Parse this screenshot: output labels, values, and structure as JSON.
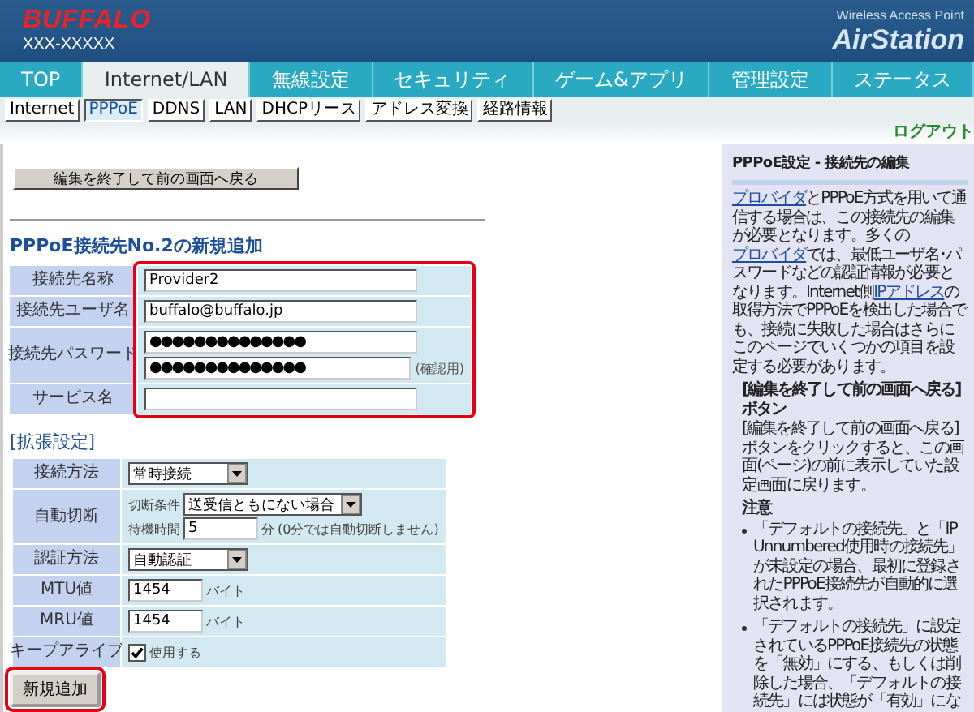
{
  "header": {
    "brand": "BUFFALO",
    "model": "XXX-XXXXX",
    "product_line": "Wireless Access Point",
    "product": "AirStation"
  },
  "nav_tabs": [
    {
      "label": "TOP",
      "selected": false
    },
    {
      "label": "Internet/LAN",
      "selected": true
    },
    {
      "label": "無線設定",
      "selected": false
    },
    {
      "label": "セキュリティ",
      "selected": false
    },
    {
      "label": "ゲーム&アプリ",
      "selected": false
    },
    {
      "label": "管理設定",
      "selected": false
    },
    {
      "label": "ステータス",
      "selected": false
    }
  ],
  "sub_tabs": [
    {
      "label": "Internet",
      "selected": false
    },
    {
      "label": "PPPoE",
      "selected": true
    },
    {
      "label": "DDNS",
      "selected": false
    },
    {
      "label": "LAN",
      "selected": false
    },
    {
      "label": "DHCPリース",
      "selected": false
    },
    {
      "label": "アドレス変換",
      "selected": false
    },
    {
      "label": "経路情報",
      "selected": false
    }
  ],
  "logout": "ログアウト",
  "back_button": "編集を終了して前の画面へ戻る",
  "form_title": "PPPoE接続先No.2の新規追加",
  "basic": {
    "highlighted": true,
    "fields": [
      {
        "kind": "text",
        "label": "接続先名称",
        "value": "Provider2"
      },
      {
        "kind": "text",
        "label": "接続先ユーザ名",
        "value": "buffalo@buffalo.jp"
      },
      {
        "kind": "password",
        "label": "接続先パスワード",
        "value": "●●●●●●●●●●●●●●",
        "confirm_value": "●●●●●●●●●●●●●●",
        "confirm_note": "(確認用)"
      },
      {
        "kind": "text",
        "label": "サービス名"
      }
    ]
  },
  "advanced": {
    "heading": "[拡張設定]",
    "rows": [
      {
        "kind": "select",
        "label": "接続方法",
        "value": "常時接続"
      },
      {
        "kind": "auto_disconnect",
        "label": "自動切断",
        "condition_label": "切断条件",
        "condition": "送受信ともにない場合",
        "wait_label": "待機時間",
        "wait": "5",
        "wait_unit": "分",
        "wait_note": "(0分では自動切断しません)"
      },
      {
        "kind": "select",
        "label": "認証方法",
        "value": "自動認証"
      },
      {
        "kind": "number",
        "label": "MTU値",
        "value": "1454",
        "unit": "バイト"
      },
      {
        "kind": "number",
        "label": "MRU値",
        "value": "1454",
        "unit": "バイト"
      },
      {
        "kind": "checkbox",
        "label": "キープアライブ",
        "checked": true,
        "text": "使用する"
      }
    ]
  },
  "add_button": {
    "label": "新規追加",
    "highlighted": true
  },
  "help": {
    "title": "PPPoE設定 - 接続先の編集",
    "intro": [
      {
        "kind": "link",
        "text": "プロバイダ"
      },
      {
        "kind": "text",
        "text": "とPPPoE方式を用いて通信する場合は、この接続先の編集が必要となります。多くの"
      },
      {
        "kind": "link",
        "text": "プロバイダ"
      },
      {
        "kind": "text",
        "text": "では、最低ユーザ名･パスワードなどの認証情報が必要となります。Internet側"
      },
      {
        "kind": "link",
        "text": "IPアドレス"
      },
      {
        "kind": "text",
        "text": "の取得方法でPPPoEを検出した場合でも、接続に失敗した場合はさらにこのページでいくつかの項目を設定する必要があります。"
      }
    ],
    "section_heading": "[編集を終了して前の画面へ戻る]ボタン",
    "section_text": "[編集を終了して前の画面へ戻る]ボタンをクリックすると、この画面(ページ)の前に表示していた設定画面に戻ります。",
    "notes_heading": "注意",
    "notes": [
      "「デフォルトの接続先」と「IP Unnumbered使用時の接続先」が未設定の場合、最初に登録されたPPPoE接続先が自動的に選択されます。",
      "「デフォルトの接続先」に設定されているPPPoE接続先の状態を「無効」にする、もしくは削除した場合、「デフォルトの接続先」には状態が「有効」にな"
    ]
  }
}
